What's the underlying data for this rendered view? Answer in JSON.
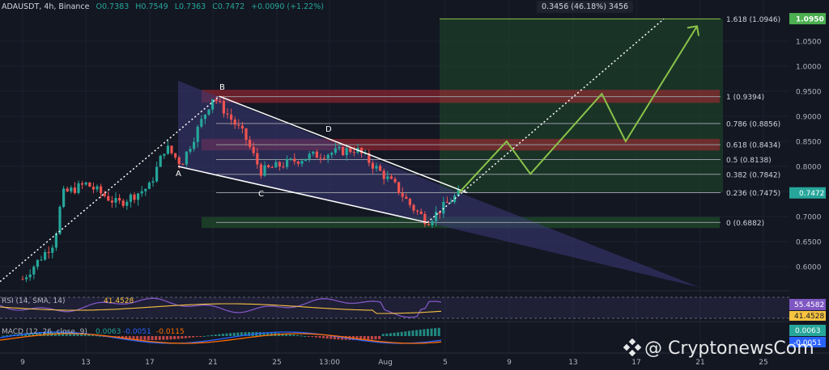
{
  "header": {
    "symbol": "ADAUSDT, 4h, Binance",
    "open": "O0.7383",
    "high": "H0.7549",
    "low": "L0.7363",
    "close": "C0.7472",
    "change": "+0.0090 (+1.22%)"
  },
  "measure_label": "0.3456 (46.18%) 3456",
  "watermark": "@ CryptonewsCom",
  "colors": {
    "background": "#131722",
    "bull": "#26a69a",
    "bear": "#ef5350",
    "pattern_line": "#ffffff",
    "projection": "#8bc34a",
    "fib_band_red": "#b22833",
    "target_zone": "#1f4d2a",
    "wedge_fill": "#3c3a7a",
    "rsi_line": "#7e57c2",
    "rsi_ma": "#f7c341",
    "macd_line": "#2962ff",
    "signal_line": "#ff6d00"
  },
  "chart_data": {
    "type": "candlestick",
    "symbol": "ADAUSDT",
    "timeframe": "4h",
    "exchange": "Binance",
    "price_axis": {
      "ticks": [
        "1.0500",
        "1.0000",
        "0.9500",
        "0.9000",
        "0.8500",
        "0.8000",
        "0.7500",
        "0.7000",
        "0.6500",
        "0.6000"
      ],
      "current_price": "0.7472",
      "target_price": "1.0950",
      "range": [
        0.56,
        1.105
      ]
    },
    "time_axis": {
      "ticks": [
        "9",
        "13",
        "17",
        "21",
        "25",
        "13:00",
        "Aug",
        "5",
        "9",
        "13",
        "17",
        "21",
        "25"
      ]
    },
    "price_path_keypoints": [
      {
        "t": "9",
        "price": 0.575
      },
      {
        "t": "11",
        "price": 0.65
      },
      {
        "t": "11.5",
        "price": 0.745
      },
      {
        "t": "13",
        "price": 0.765
      },
      {
        "t": "15",
        "price": 0.725
      },
      {
        "t": "17",
        "price": 0.76
      },
      {
        "t": "18",
        "price": 0.84
      },
      {
        "t": "19",
        "price": 0.805
      },
      {
        "t": "21",
        "price": 0.94
      },
      {
        "t": "23",
        "price": 0.86
      },
      {
        "t": "24",
        "price": 0.79
      },
      {
        "t": "27",
        "price": 0.82
      },
      {
        "t": "30",
        "price": 0.835
      },
      {
        "t": "Aug 1",
        "price": 0.76
      },
      {
        "t": "Aug 2",
        "price": 0.72
      },
      {
        "t": "Aug 3",
        "price": 0.69
      },
      {
        "t": "Aug 5",
        "price": 0.7472
      }
    ],
    "pattern_points": [
      {
        "label": "A",
        "t": "19",
        "price": 0.8
      },
      {
        "label": "B",
        "t": "21",
        "price": 0.94
      },
      {
        "label": "C",
        "t": "24",
        "price": 0.76
      },
      {
        "label": "D",
        "t": "27",
        "price": 0.855
      }
    ],
    "fibonacci": [
      {
        "label": "1.618 (1.0946)",
        "price": 1.0946
      },
      {
        "label": "1 (0.9394)",
        "price": 0.9394
      },
      {
        "label": "0.786 (0.8856)",
        "price": 0.8856
      },
      {
        "label": "0.618 (0.8434)",
        "price": 0.8434
      },
      {
        "label": "0.5 (0.8138)",
        "price": 0.8138
      },
      {
        "label": "0.382 (0.7842)",
        "price": 0.7842
      },
      {
        "label": "0.236 (0.7475)",
        "price": 0.7475
      },
      {
        "label": "0 (0.6882)",
        "price": 0.6882
      }
    ],
    "projection_path": [
      {
        "t": "5",
        "price": 0.7475
      },
      {
        "t": "8",
        "price": 0.85
      },
      {
        "t": "9.5",
        "price": 0.785
      },
      {
        "t": "14",
        "price": 0.945
      },
      {
        "t": "15.5",
        "price": 0.85
      },
      {
        "t": "20",
        "price": 1.08
      }
    ],
    "measure": {
      "value": 0.3456,
      "percent": "46.18%",
      "bars": 3456
    },
    "rsi": {
      "label": "RSI (14, SMA, 14)",
      "rsi_value": "55.4582",
      "ma_value": "41.4528"
    },
    "macd": {
      "label": "MACD (12, 26, close, 9)",
      "histogram": "0.0063",
      "macd": "-0.0051",
      "signal": "-0.0115"
    }
  }
}
